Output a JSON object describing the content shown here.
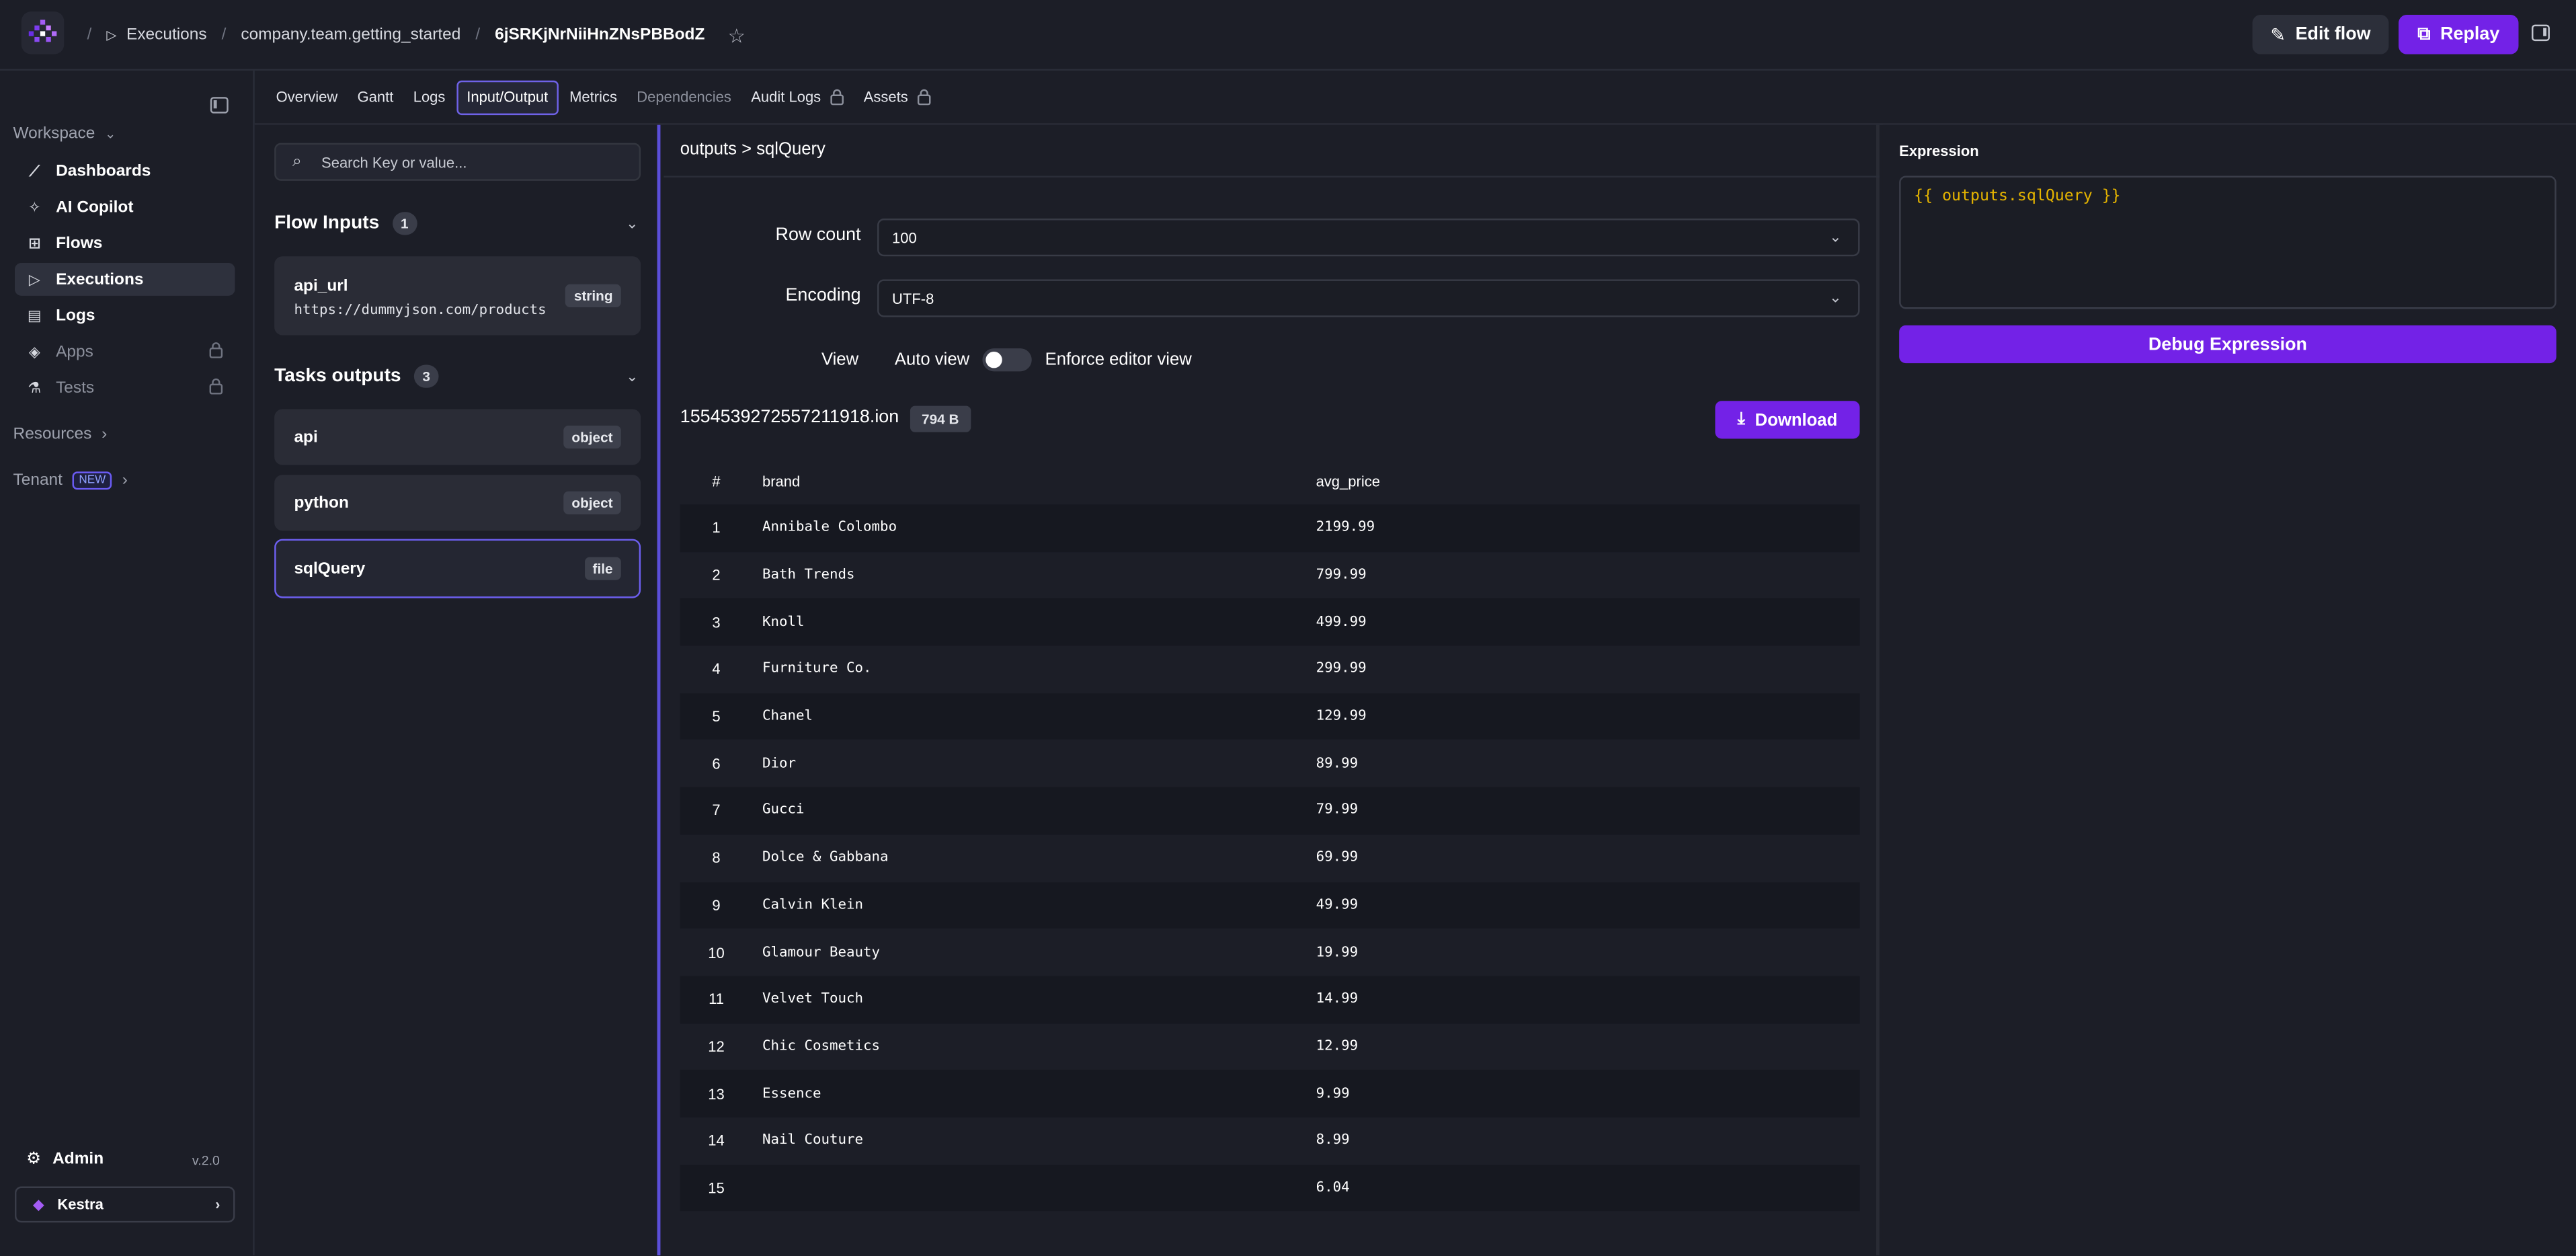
{
  "header": {
    "breadcrumb_sep": "/",
    "executions_label": "Executions",
    "namespace_flow": "company.team.getting_started",
    "execution_id": "6jSRKjNrNiiHnZNsPBBodZ",
    "edit_flow_label": "Edit flow",
    "replay_label": "Replay"
  },
  "sidebar": {
    "workspace_label": "Workspace",
    "items": [
      {
        "label": "Dashboards",
        "icon": "chart-line-icon"
      },
      {
        "label": "AI Copilot",
        "icon": "sparkle-icon"
      },
      {
        "label": "Flows",
        "icon": "flow-icon"
      },
      {
        "label": "Executions",
        "icon": "play-icon"
      },
      {
        "label": "Logs",
        "icon": "logs-icon"
      },
      {
        "label": "Apps",
        "icon": "layers-icon"
      },
      {
        "label": "Tests",
        "icon": "flask-icon"
      }
    ],
    "resources_label": "Resources",
    "tenant_label": "Tenant",
    "new_badge": "NEW",
    "admin_label": "Admin",
    "version": "v.2.0",
    "tenant_name": "Kestra"
  },
  "tabs": [
    "Overview",
    "Gantt",
    "Logs",
    "Input/Output",
    "Metrics",
    "Dependencies",
    "Audit Logs",
    "Assets"
  ],
  "io": {
    "search_placeholder": "Search Key or value...",
    "flow_inputs_title": "Flow Inputs",
    "flow_inputs_count": "1",
    "inputs": [
      {
        "name": "api_url",
        "value": "https://dummyjson.com/products",
        "type": "string"
      }
    ],
    "task_outputs_title": "Tasks outputs",
    "task_outputs_count": "3",
    "outputs": [
      {
        "name": "api",
        "type": "object"
      },
      {
        "name": "python",
        "type": "object"
      },
      {
        "name": "sqlQuery",
        "type": "file"
      }
    ]
  },
  "preview": {
    "path": "outputs > sqlQuery",
    "row_count_label": "Row count",
    "row_count_value": "100",
    "encoding_label": "Encoding",
    "encoding_value": "UTF-8",
    "view_label": "View",
    "auto_view_label": "Auto view",
    "enforce_label": "Enforce editor view",
    "file_name": "1554539272557211918.ion",
    "file_size": "794 B",
    "download_label": "Download",
    "columns": [
      "#",
      "brand",
      "avg_price"
    ],
    "rows": [
      [
        "1",
        "Annibale Colombo",
        "2199.99"
      ],
      [
        "2",
        "Bath Trends",
        "799.99"
      ],
      [
        "3",
        "Knoll",
        "499.99"
      ],
      [
        "4",
        "Furniture Co.",
        "299.99"
      ],
      [
        "5",
        "Chanel",
        "129.99"
      ],
      [
        "6",
        "Dior",
        "89.99"
      ],
      [
        "7",
        "Gucci",
        "79.99"
      ],
      [
        "8",
        "Dolce & Gabbana",
        "69.99"
      ],
      [
        "9",
        "Calvin Klein",
        "49.99"
      ],
      [
        "10",
        "Glamour Beauty",
        "19.99"
      ],
      [
        "11",
        "Velvet Touch",
        "14.99"
      ],
      [
        "12",
        "Chic Cosmetics",
        "12.99"
      ],
      [
        "13",
        "Essence",
        "9.99"
      ],
      [
        "14",
        "Nail Couture",
        "8.99"
      ],
      [
        "15",
        "",
        "6.04"
      ]
    ]
  },
  "expression": {
    "label": "Expression",
    "value": "{{ outputs.sqlQuery }}",
    "debug_label": "Debug Expression"
  },
  "colors": {
    "accent": "#7322e7",
    "background": "#1c1e27",
    "selection_border": "#6d5ff0",
    "expression_text": "#e5b400"
  }
}
